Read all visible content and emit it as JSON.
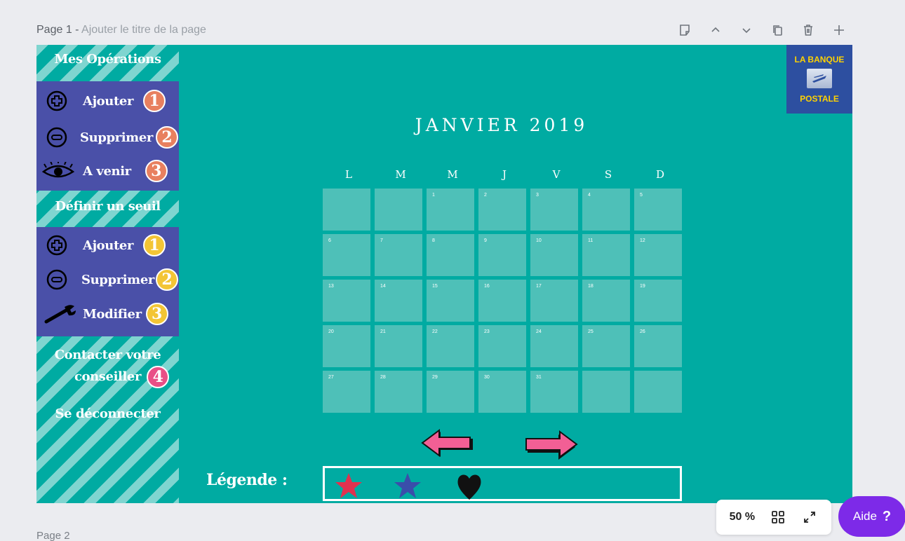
{
  "header": {
    "page_label": "Page 1 - ",
    "title_placeholder": "Ajouter le titre de la page",
    "tools": [
      "note-icon",
      "chevron-up-icon",
      "chevron-down-icon",
      "duplicate-icon",
      "trash-icon",
      "plus-icon"
    ]
  },
  "sidebar": {
    "operations_heading": "Mes Opérations",
    "operations_items": [
      {
        "label": "Ajouter",
        "badge": "1",
        "icon": "plus-circle-icon"
      },
      {
        "label": "Supprimer",
        "badge": "2",
        "icon": "minus-circle-icon"
      },
      {
        "label": "A venir",
        "badge": "3",
        "icon": "eye-icon"
      }
    ],
    "threshold_heading": "Définir un seuil",
    "threshold_items": [
      {
        "label": "Ajouter",
        "badge": "1",
        "icon": "plus-circle-icon"
      },
      {
        "label": "Supprimer",
        "badge": "2",
        "icon": "minus-circle-icon"
      },
      {
        "label": "Modifier",
        "badge": "3",
        "icon": "wrench-icon"
      }
    ],
    "contact_line1": "Contacter votre",
    "contact_line2": "conseiller",
    "contact_badge": "4",
    "logout": "Se déconnecter"
  },
  "logo": {
    "line1": "LA BANQUE",
    "line2": "POSTALE"
  },
  "calendar": {
    "title": "JANVIER 2019",
    "day_headers": [
      "L",
      "M",
      "M",
      "J",
      "V",
      "S",
      "D"
    ],
    "cells": [
      "",
      "",
      "1",
      "2",
      "3",
      "4",
      "5",
      "6",
      "7",
      "8",
      "9",
      "10",
      "11",
      "12",
      "13",
      "14",
      "15",
      "16",
      "17",
      "18",
      "19",
      "20",
      "21",
      "22",
      "23",
      "24",
      "25",
      "26",
      "27",
      "28",
      "29",
      "30",
      "31",
      "",
      ""
    ]
  },
  "legend": {
    "label": "Légende :",
    "items": [
      {
        "icon": "red-star-icon",
        "color": "#e0314f"
      },
      {
        "icon": "blue-star-icon",
        "color": "#3a4eaa"
      },
      {
        "icon": "black-heart-icon",
        "color": "#111111"
      }
    ]
  },
  "colors": {
    "canvas": "#00aba2",
    "menu": "#4a50a8",
    "accent": "#7d2ae8",
    "arrow": "#f25f95"
  },
  "footer": {
    "page2_label": "Page 2"
  },
  "zoom": {
    "value": "50 %"
  },
  "help": {
    "label": "Aide",
    "icon_text": "?"
  }
}
